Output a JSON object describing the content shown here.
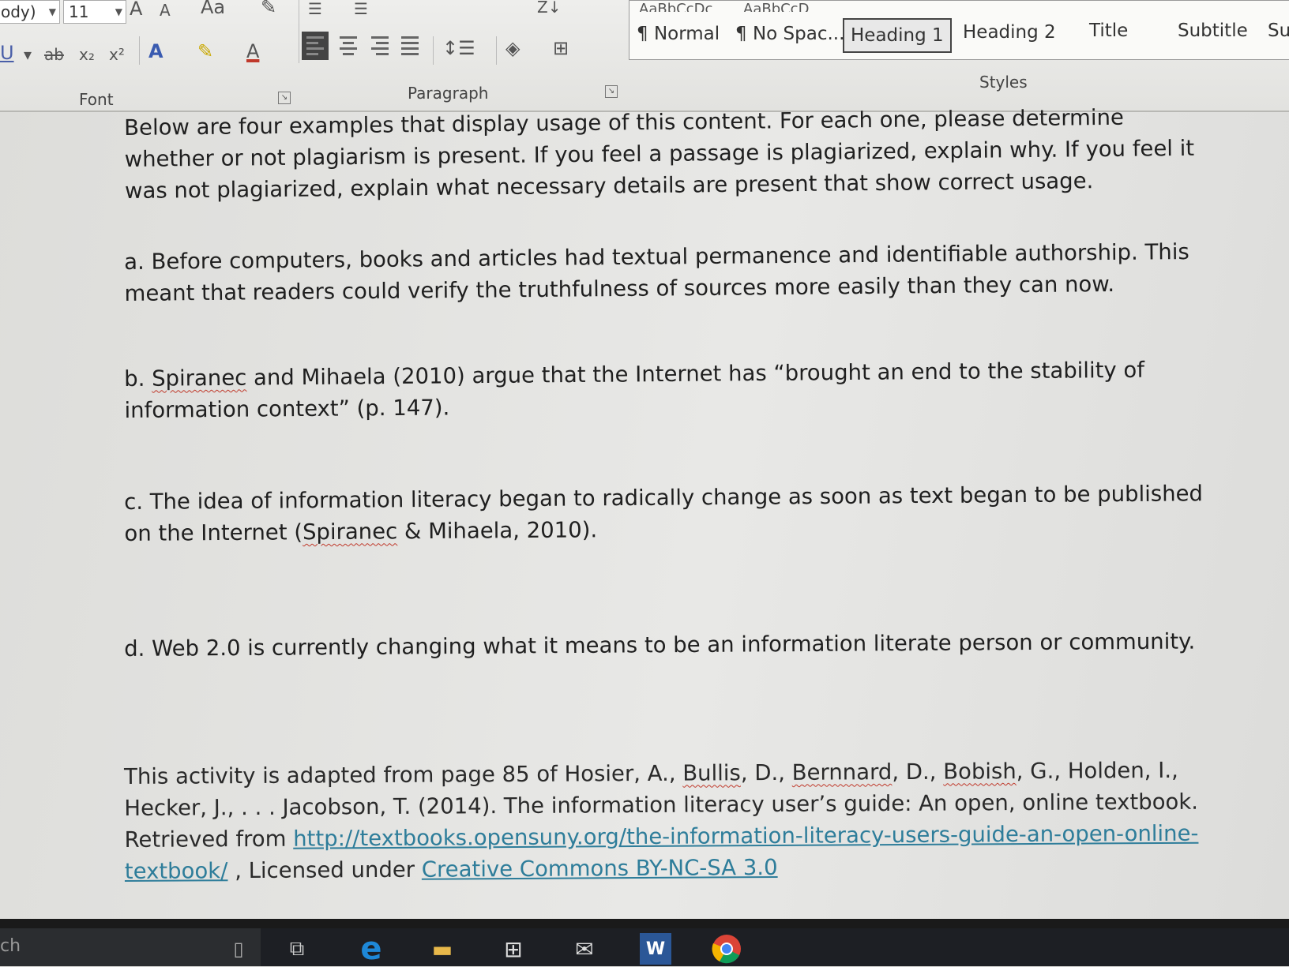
{
  "ribbon": {
    "font_name": "ody)",
    "font_size": "11",
    "font_group_label": "Font",
    "paragraph_group_label": "Paragraph",
    "styles_group_label": "Styles",
    "buttons": {
      "grow_font": "A",
      "shrink_font": "A",
      "change_case": "Aa",
      "underline": "U",
      "strikethrough": "ab",
      "subscript": "x₂",
      "superscript": "x²",
      "text_effects": "A",
      "font_color": "A"
    },
    "style_previews": [
      "AaBbCcDc",
      "AaBbCcD"
    ],
    "styles": [
      {
        "label": "¶ Normal"
      },
      {
        "label": "¶ No Spac..."
      },
      {
        "label": "Heading 1"
      },
      {
        "label": "Heading 2"
      },
      {
        "label": "Title"
      },
      {
        "label": "Subtitle"
      },
      {
        "label": "Sul"
      }
    ]
  },
  "document": {
    "intro": "Below are four examples that display usage of this content. For each one, please determine whether or not plagiarism is present. If you feel a passage is plagiarized, explain why. If you feel it was not plagiarized, explain what necessary details are present that show correct usage.",
    "example_a": "a. Before computers, books and articles had textual permanence and identifiable authorship. This meant that readers could verify the truthfulness of sources more easily than they can now.",
    "example_b": {
      "prefix": "b. ",
      "misspelled": "Spiranec",
      "rest": " and Mihaela (2010) argue that the Internet has “brought an end to the stability of information context” (p. 147)."
    },
    "example_c": {
      "prefix": "c. The idea of information literacy began to radically change as soon as text began to be published on the Internet (",
      "misspelled": "Spiranec",
      "rest": " & Mihaela, 2010)."
    },
    "example_d": "d. Web 2.0 is currently changing what it means to be an information literate person or community.",
    "source": {
      "part1": "This activity is adapted from page 85 of Hosier, A., ",
      "name1": "Bullis",
      "part2": ", D., ",
      "name2": "Bernnard",
      "part3": ", D., ",
      "name3": "Bobish",
      "part4": ", G., Holden, I., Hecker, J., . . . Jacobson, T. (2014). The information literacy user’s guide: An open, online textbook. Retrieved from ",
      "url": "http://textbooks.opensuny.org/the-information-literacy-users-guide-an-open-online-textbook/",
      "part5": " , Licensed under ",
      "license": "Creative Commons BY-NC-SA 3.0"
    }
  },
  "taskbar": {
    "search_fragment": "ch",
    "icons": [
      "phone-icon",
      "task-view-icon",
      "edge-icon",
      "file-explorer-icon",
      "store-icon",
      "mail-icon",
      "word-icon",
      "chrome-icon"
    ]
  }
}
